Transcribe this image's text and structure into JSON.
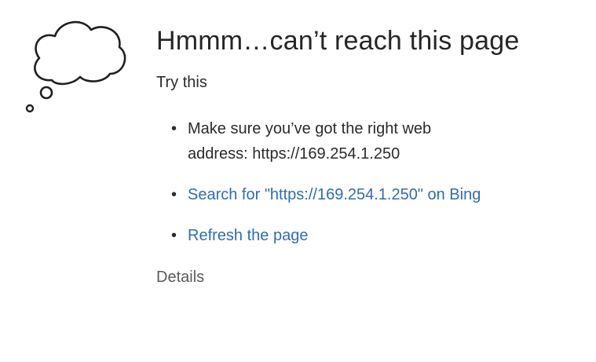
{
  "error_page": {
    "title": "Hmmm…can’t reach this page",
    "subtitle": "Try this",
    "suggestions": [
      {
        "bullet": "•",
        "line1": "Make sure you’ve got the right web",
        "line2": "address: https://169.254.1.250"
      },
      {
        "bullet": "•",
        "label": "Search for \"https://169.254.1.250\" on Bing"
      },
      {
        "bullet": "•",
        "label": "Refresh the page"
      }
    ],
    "details_label": "Details"
  },
  "icons": {
    "illustration": "thought-cloud-icon"
  },
  "colors": {
    "link": "#2f6cb5",
    "text": "#262626",
    "muted": "#5a5a5a",
    "background": "#ffffff"
  }
}
